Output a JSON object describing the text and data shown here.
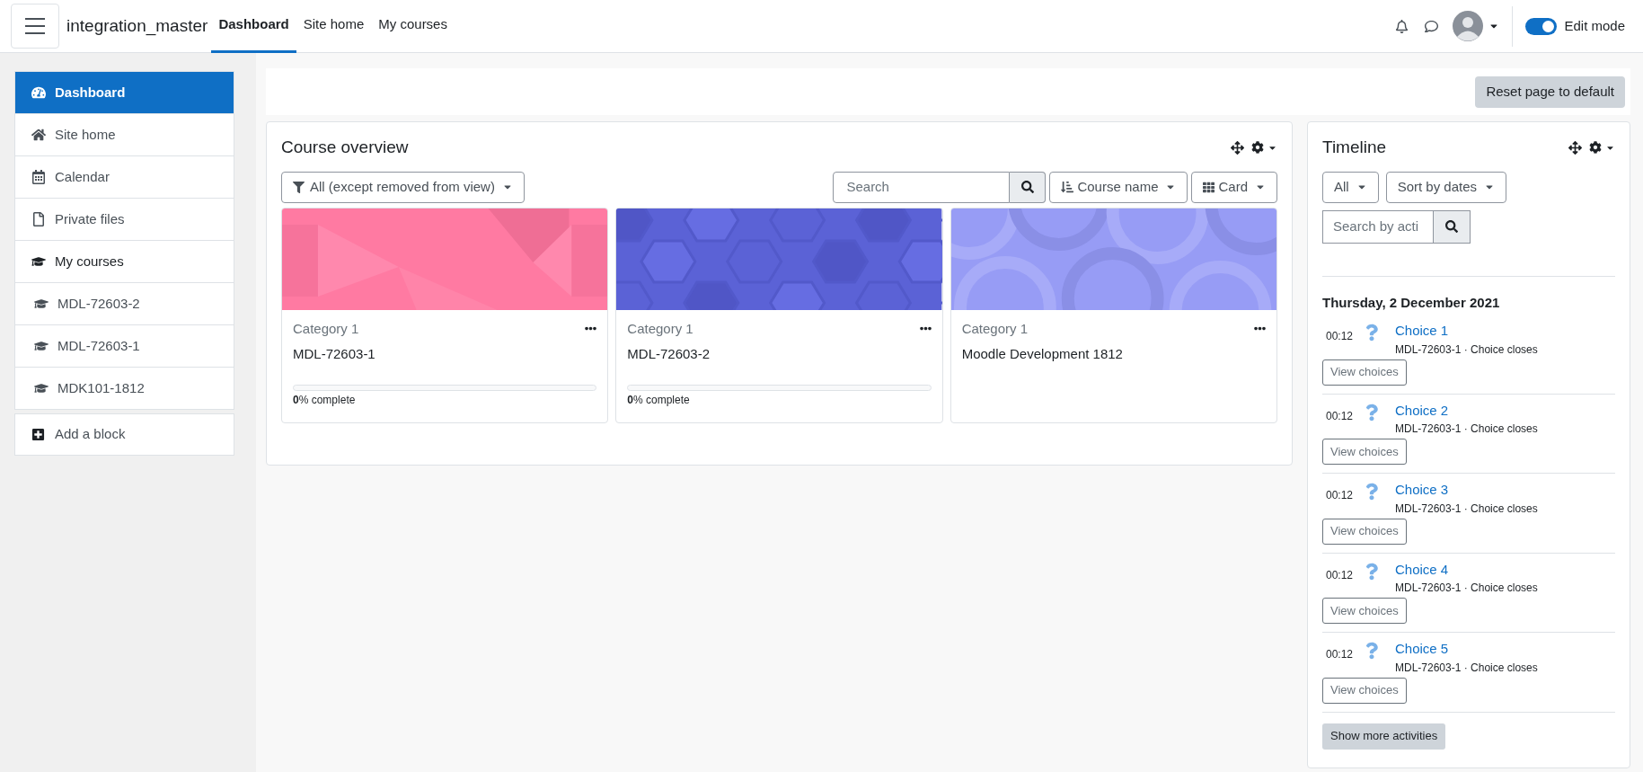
{
  "header": {
    "site_name": "integration_master",
    "nav": [
      {
        "label": "Dashboard",
        "selected": true
      },
      {
        "label": "Site home",
        "selected": false
      },
      {
        "label": "My courses",
        "selected": false
      }
    ],
    "edit_mode": {
      "label": "Edit mode",
      "on": true
    }
  },
  "sidebar": {
    "items": [
      {
        "kind": "dashboard",
        "label": "Dashboard",
        "selected": true
      },
      {
        "kind": "home",
        "label": "Site home",
        "selected": false
      },
      {
        "kind": "calendar",
        "label": "Calendar",
        "selected": false
      },
      {
        "kind": "file",
        "label": "Private files",
        "selected": false
      },
      {
        "kind": "courses",
        "label": "My courses",
        "selected": false,
        "children": [
          {
            "kind": "course",
            "label": "MDL-72603-2",
            "selected": false
          },
          {
            "kind": "course",
            "label": "MDL-72603-1",
            "selected": false
          },
          {
            "kind": "course",
            "label": "MDK101-1812",
            "selected": false
          }
        ]
      }
    ],
    "add_block": "Add a block"
  },
  "reset_button": "Reset page to default",
  "course_overview": {
    "title": "Course overview",
    "filter": "All (except removed from view)",
    "search": {
      "placeholder": "Search"
    },
    "sort": "Course name",
    "view": "Card",
    "courses": [
      {
        "category": "Category 1",
        "name": "MDL-72603-1",
        "progress": {
          "level": 0,
          "text": "**0**% complete"
        }
      },
      {
        "category": "Category 1",
        "name": "MDL-72603-2",
        "progress": {
          "level": 0,
          "text": "**0**% complete"
        }
      },
      {
        "category": "Category 1",
        "name": "Moodle Development 1812"
      }
    ]
  },
  "timeline": {
    "title": "Timeline",
    "filter": "All",
    "sort": "Sort by dates",
    "search": {
      "placeholder": "Search by acti"
    },
    "date": "Thursday, 2 December 2021",
    "events": [
      {
        "time": "00:12",
        "title": "Choice 1",
        "details": "MDL-72603-1 · Choice closes",
        "action": "View choices"
      },
      {
        "time": "00:12",
        "title": "Choice 2",
        "details": "MDL-72603-1 · Choice closes",
        "action": "View choices"
      },
      {
        "time": "00:12",
        "title": "Choice 3",
        "details": "MDL-72603-1 · Choice closes",
        "action": "View choices"
      },
      {
        "time": "00:12",
        "title": "Choice 4",
        "details": "MDL-72603-1 · Choice closes",
        "action": "View choices"
      },
      {
        "time": "00:12",
        "title": "Choice 5",
        "details": "MDL-72603-1 · Choice closes",
        "action": "View choices"
      }
    ],
    "show_more": "Show more activities"
  }
}
